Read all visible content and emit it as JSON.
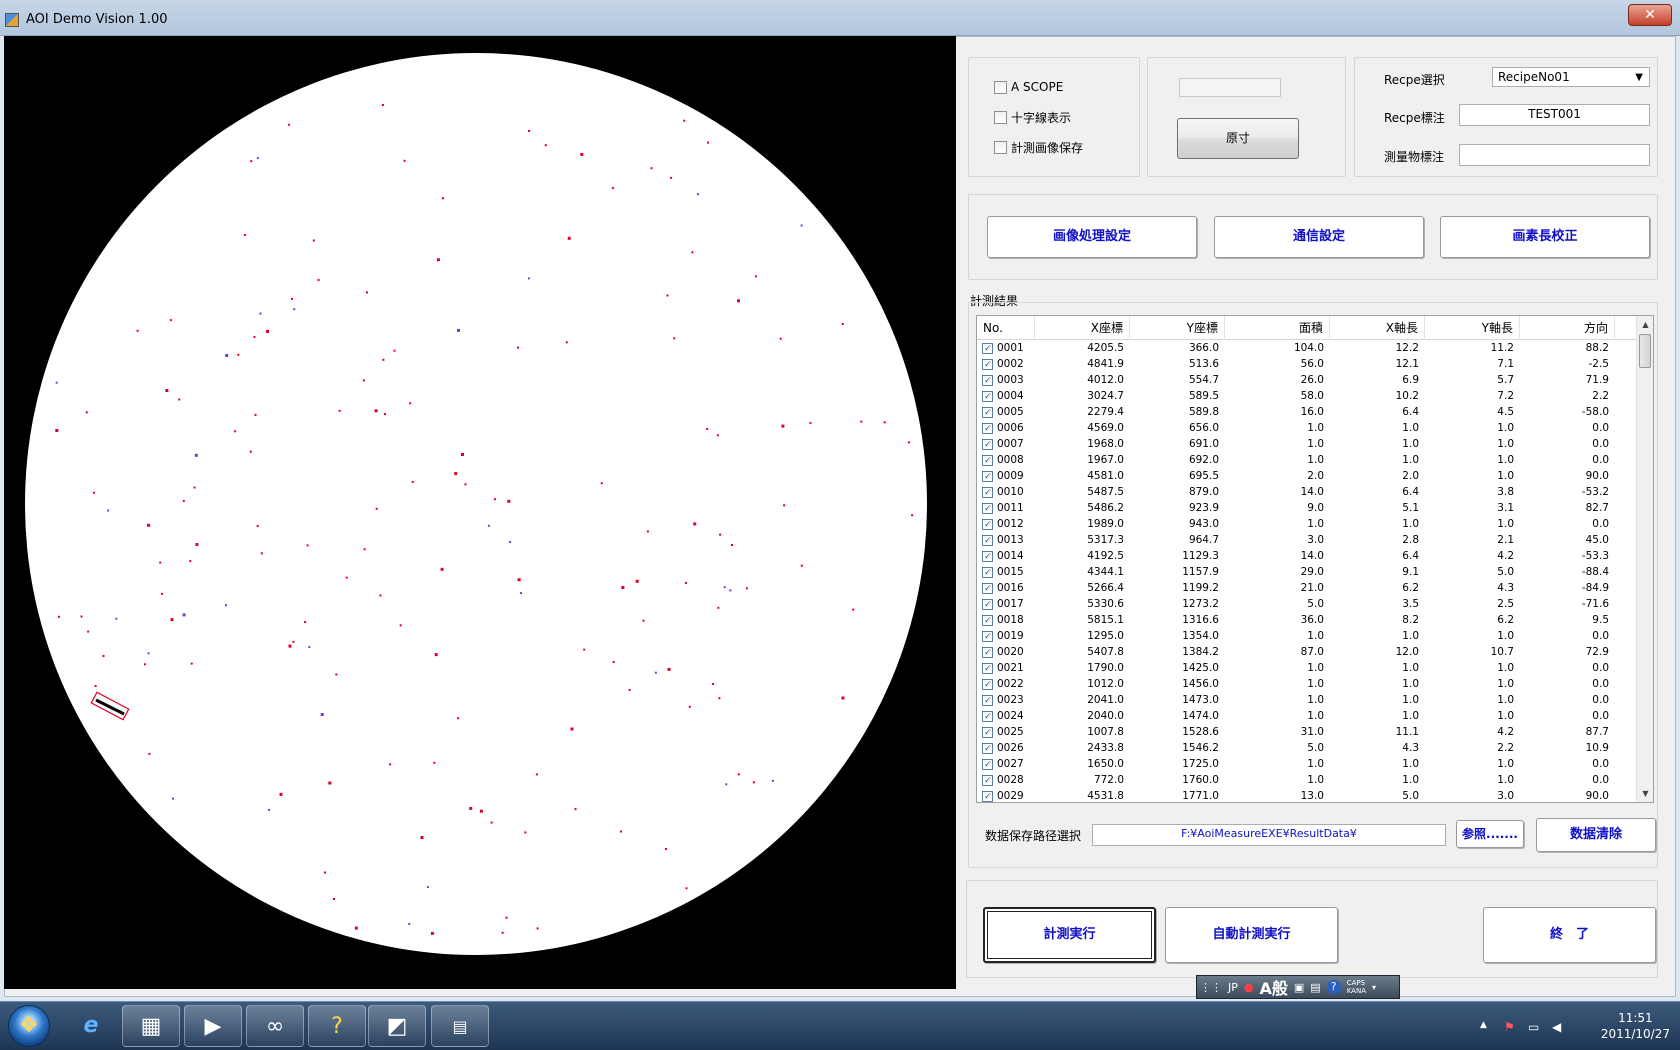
{
  "window": {
    "title": "AOI Demo Vision 1.00",
    "close_glyph": "✕"
  },
  "options": {
    "ascope": "A SCOPE",
    "crosshair": "十字線表示",
    "save_image": "計測画像保存"
  },
  "actual_size_button": "原寸",
  "recipe": {
    "select_label": "Recpe選択",
    "select_value": "RecipeNo01",
    "note_label": "Recpe標注",
    "note_value": "TEST001",
    "object_label": "測量物標注",
    "object_value": ""
  },
  "settings": {
    "image_processing": "画像処理設定",
    "communication": "通信設定",
    "pixel_calibration": "画素長校正"
  },
  "results_label": "計測結果",
  "table": {
    "headers": [
      "No.",
      "X座標",
      "Y座標",
      "面積",
      "X軸長",
      "Y軸長",
      "方向"
    ],
    "rows": [
      [
        "0001",
        "4205.5",
        "366.0",
        "104.0",
        "12.2",
        "11.2",
        "88.2"
      ],
      [
        "0002",
        "4841.9",
        "513.6",
        "56.0",
        "12.1",
        "7.1",
        "-2.5"
      ],
      [
        "0003",
        "4012.0",
        "554.7",
        "26.0",
        "6.9",
        "5.7",
        "71.9"
      ],
      [
        "0004",
        "3024.7",
        "589.5",
        "58.0",
        "10.2",
        "7.2",
        "2.2"
      ],
      [
        "0005",
        "2279.4",
        "589.8",
        "16.0",
        "6.4",
        "4.5",
        "-58.0"
      ],
      [
        "0006",
        "4569.0",
        "656.0",
        "1.0",
        "1.0",
        "1.0",
        "0.0"
      ],
      [
        "0007",
        "1968.0",
        "691.0",
        "1.0",
        "1.0",
        "1.0",
        "0.0"
      ],
      [
        "0008",
        "1967.0",
        "692.0",
        "1.0",
        "1.0",
        "1.0",
        "0.0"
      ],
      [
        "0009",
        "4581.0",
        "695.5",
        "2.0",
        "2.0",
        "1.0",
        "90.0"
      ],
      [
        "0010",
        "5487.5",
        "879.0",
        "14.0",
        "6.4",
        "3.8",
        "-53.2"
      ],
      [
        "0011",
        "5486.2",
        "923.9",
        "9.0",
        "5.1",
        "3.1",
        "82.7"
      ],
      [
        "0012",
        "1989.0",
        "943.0",
        "1.0",
        "1.0",
        "1.0",
        "0.0"
      ],
      [
        "0013",
        "5317.3",
        "964.7",
        "3.0",
        "2.8",
        "2.1",
        "45.0"
      ],
      [
        "0014",
        "4192.5",
        "1129.3",
        "14.0",
        "6.4",
        "4.2",
        "-53.3"
      ],
      [
        "0015",
        "4344.1",
        "1157.9",
        "29.0",
        "9.1",
        "5.0",
        "-88.4"
      ],
      [
        "0016",
        "5266.4",
        "1199.2",
        "21.0",
        "6.2",
        "4.3",
        "-84.9"
      ],
      [
        "0017",
        "5330.6",
        "1273.2",
        "5.0",
        "3.5",
        "2.5",
        "-71.6"
      ],
      [
        "0018",
        "5815.1",
        "1316.6",
        "36.0",
        "8.2",
        "6.2",
        "9.5"
      ],
      [
        "0019",
        "1295.0",
        "1354.0",
        "1.0",
        "1.0",
        "1.0",
        "0.0"
      ],
      [
        "0020",
        "5407.8",
        "1384.2",
        "87.0",
        "12.0",
        "10.7",
        "72.9"
      ],
      [
        "0021",
        "1790.0",
        "1425.0",
        "1.0",
        "1.0",
        "1.0",
        "0.0"
      ],
      [
        "0022",
        "1012.0",
        "1456.0",
        "1.0",
        "1.0",
        "1.0",
        "0.0"
      ],
      [
        "0023",
        "2041.0",
        "1473.0",
        "1.0",
        "1.0",
        "1.0",
        "0.0"
      ],
      [
        "0024",
        "2040.0",
        "1474.0",
        "1.0",
        "1.0",
        "1.0",
        "0.0"
      ],
      [
        "0025",
        "1007.8",
        "1528.6",
        "31.0",
        "11.1",
        "4.2",
        "87.7"
      ],
      [
        "0026",
        "2433.8",
        "1546.2",
        "5.0",
        "4.3",
        "2.2",
        "10.9"
      ],
      [
        "0027",
        "1650.0",
        "1725.0",
        "1.0",
        "1.0",
        "1.0",
        "0.0"
      ],
      [
        "0028",
        "772.0",
        "1760.0",
        "1.0",
        "1.0",
        "1.0",
        "0.0"
      ],
      [
        "0029",
        "4531.8",
        "1771.0",
        "13.0",
        "5.0",
        "3.0",
        "90.0"
      ]
    ]
  },
  "save_path": {
    "label": "数据保存路径選択",
    "value": "F:¥AoiMeasureEXE¥ResultData¥",
    "browse": "参照.......",
    "clear": "数据清除"
  },
  "actions": {
    "measure": "計測実行",
    "auto_measure": "自動計測実行",
    "exit": "終　了"
  },
  "ime": {
    "lang": "JP",
    "mode": "A般",
    "caps": "CAPS",
    "kana": "KANA"
  },
  "taskbar": {
    "time": "11:51",
    "date": "2011/10/27"
  },
  "colors": {
    "defect": "#e0002a",
    "defect_alt": "#7a3bd6",
    "button_text": "#1010c8"
  }
}
